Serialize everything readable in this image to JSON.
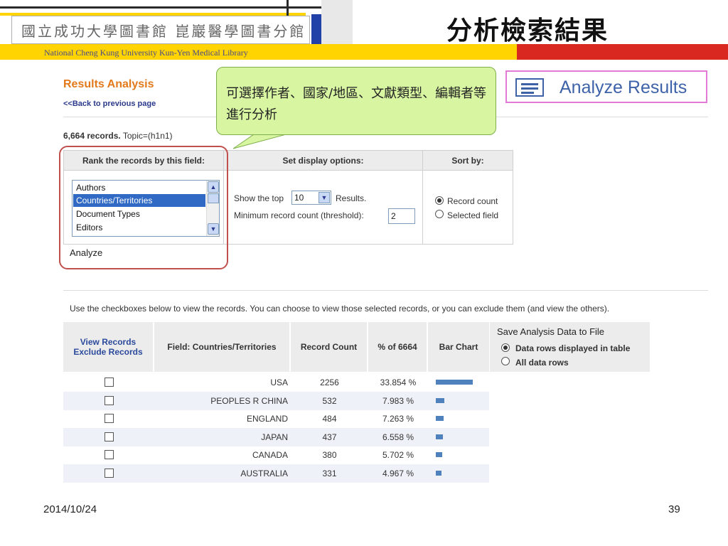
{
  "header": {
    "library_name_chinese": "國立成功大學圖書館 崑巖醫學圖書分館",
    "library_name_english": "National Cheng Kung University Kun-Yen Medical Library",
    "slide_title": "分析檢索結果"
  },
  "page": {
    "results_analysis_title": "Results Analysis",
    "back_link": "<<Back to previous page",
    "record_count_bold": "6,664 records.",
    "topic": "Topic=(h1n1)"
  },
  "analyze_results_badge": {
    "label": "Analyze Results"
  },
  "callout": {
    "text": "可選擇作者、國家/地區、文獻類型、編輯者等進行分析"
  },
  "options": {
    "col_rank": "Rank the records by this field:",
    "col_display": "Set display options:",
    "col_sort": "Sort by:",
    "fields": [
      "Authors",
      "Countries/Territories",
      "Document Types",
      "Editors"
    ],
    "selected_field": "Countries/Territories",
    "show_top_label": "Show the top",
    "show_top_value": "10",
    "results_label": "Results.",
    "threshold_label": "Minimum record count (threshold):",
    "threshold_value": "2",
    "sort_record_count": "Record count",
    "sort_selected_field": "Selected field",
    "analyze_button": "Analyze"
  },
  "instructions": "Use the checkboxes below to view the records. You can choose to view those selected records, or you can exclude them (and view the others).",
  "results_table": {
    "view_records": "View Records",
    "exclude_records": "Exclude Records",
    "col_field": "Field: Countries/Territories",
    "col_record_count": "Record Count",
    "col_percent": "% of 6664",
    "col_bar": "Bar Chart",
    "rows": [
      {
        "country": "USA",
        "count": "2256",
        "percent": "33.854 %",
        "share": 33.854
      },
      {
        "country": "PEOPLES R CHINA",
        "count": "532",
        "percent": "7.983 %",
        "share": 7.983
      },
      {
        "country": "ENGLAND",
        "count": "484",
        "percent": "7.263 %",
        "share": 7.263
      },
      {
        "country": "JAPAN",
        "count": "437",
        "percent": "6.558 %",
        "share": 6.558
      },
      {
        "country": "CANADA",
        "count": "380",
        "percent": "5.702 %",
        "share": 5.702
      },
      {
        "country": "AUSTRALIA",
        "count": "331",
        "percent": "4.967 %",
        "share": 4.967
      }
    ]
  },
  "save_panel": {
    "title": "Save Analysis Data to File",
    "option_table": "Data rows displayed in table",
    "option_all": "All data rows"
  },
  "footer": {
    "date": "2014/10/24",
    "page_number": "39"
  },
  "colors": {
    "accent_orange": "#e27a1c",
    "link_blue": "#2b3a8c",
    "bar_blue": "#4f81bd",
    "callout_green": "#d8f5a2",
    "highlight_red": "#c0504d",
    "header_yellow": "#ffd400",
    "header_red": "#d8281f"
  }
}
